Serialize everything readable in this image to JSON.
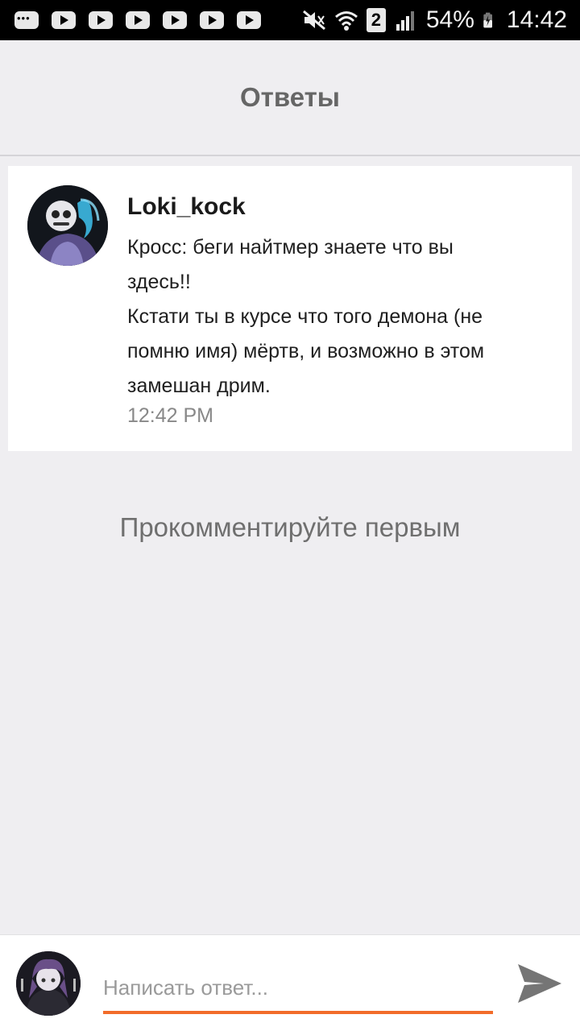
{
  "status_bar": {
    "battery": "54%",
    "time": "14:42",
    "sim_label": "2",
    "notification_icons": [
      "chat-bubble-icon",
      "youtube-icon",
      "youtube-icon",
      "youtube-icon",
      "youtube-icon",
      "youtube-icon",
      "youtube-icon"
    ]
  },
  "header": {
    "title": "Ответы"
  },
  "comment": {
    "author": "Loki_kock",
    "lines": [
      "Кросс: беги найтмер знаете что вы",
      "здесь!!",
      "Кстати ты в курсе что того демона (не",
      "помню имя) мёртв, и возможно в этом",
      "замешан дрим."
    ],
    "time": "12:42 PM"
  },
  "empty_state": "Прокомментируйте первым",
  "composer": {
    "placeholder": "Написать ответ...",
    "accent_color": "#f26c2a"
  }
}
